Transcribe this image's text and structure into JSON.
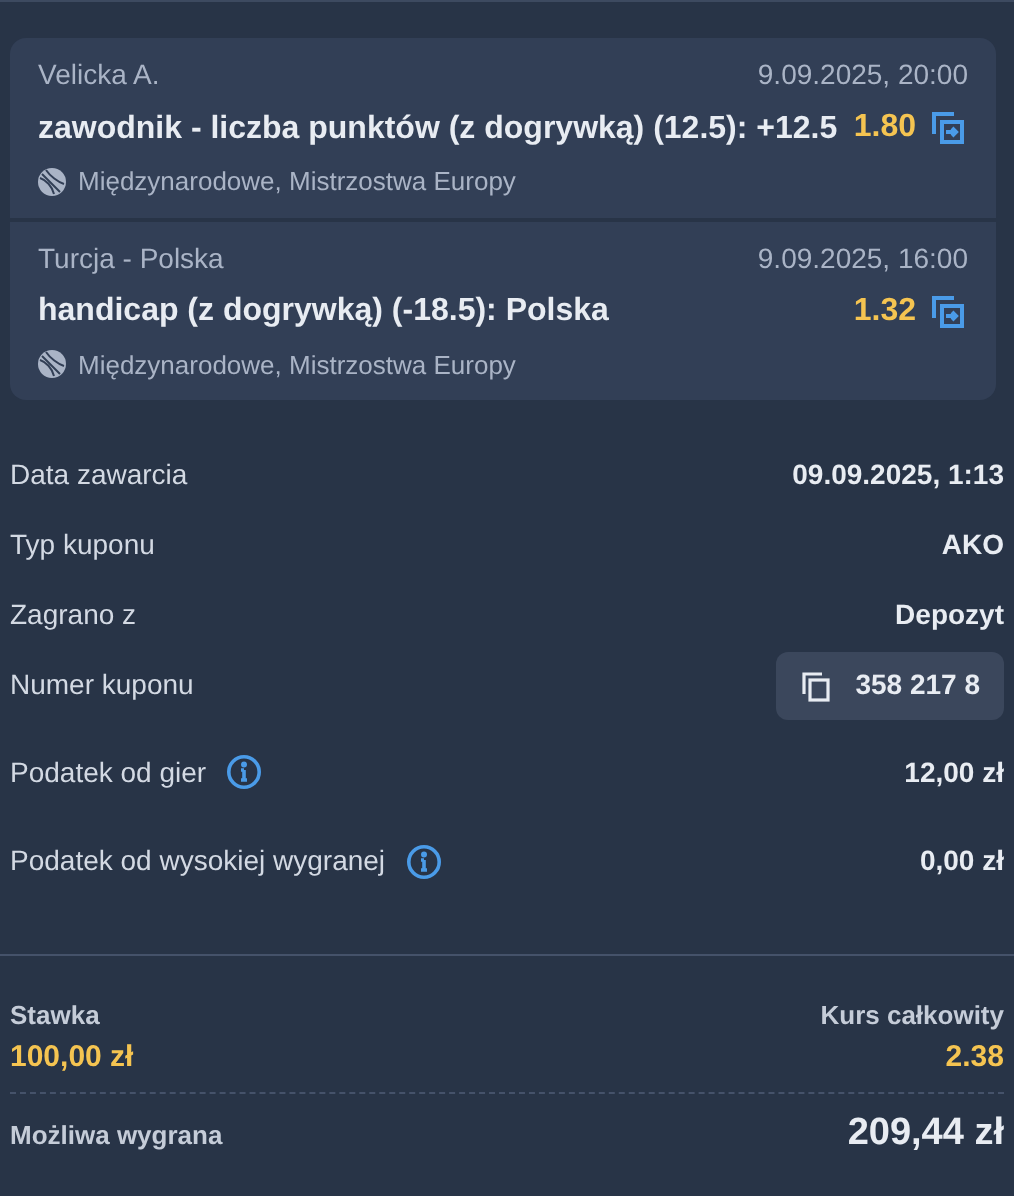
{
  "bets": [
    {
      "event": "Velicka A.",
      "datetime": "9.09.2025, 20:00",
      "selection": "zawodnik - liczba punktów (z dogrywką) (12.5): +12.5",
      "odds": "1.80",
      "league": "Międzynarodowe, Mistrzostwa Europy"
    },
    {
      "event": "Turcja - Polska",
      "datetime": "9.09.2025, 16:00",
      "selection": "handicap (z dogrywką) (-18.5): Polska",
      "odds": "1.32",
      "league": "Międzynarodowe, Mistrzostwa Europy"
    }
  ],
  "details": [
    {
      "kind": "plain",
      "label": "Data zawarcia",
      "value": "09.09.2025, 1:13"
    },
    {
      "kind": "plain",
      "label": "Typ kuponu",
      "value": "AKO"
    },
    {
      "kind": "plain",
      "label": "Zagrano z",
      "value": "Depozyt"
    },
    {
      "kind": "copy",
      "label": "Numer kuponu",
      "value": "358 217 8"
    },
    {
      "kind": "info",
      "label": "Podatek od gier",
      "value": "12,00 zł"
    },
    {
      "kind": "info",
      "label": "Podatek od wysokiej wygranej",
      "value": "0,00 zł"
    }
  ],
  "summary": {
    "stake_label": "Stawka",
    "stake": "100,00 zł",
    "total_odds_label": "Kurs całkowity",
    "total_odds": "2.38",
    "win_label": "Możliwa wygrana",
    "win": "209,44 zł"
  }
}
